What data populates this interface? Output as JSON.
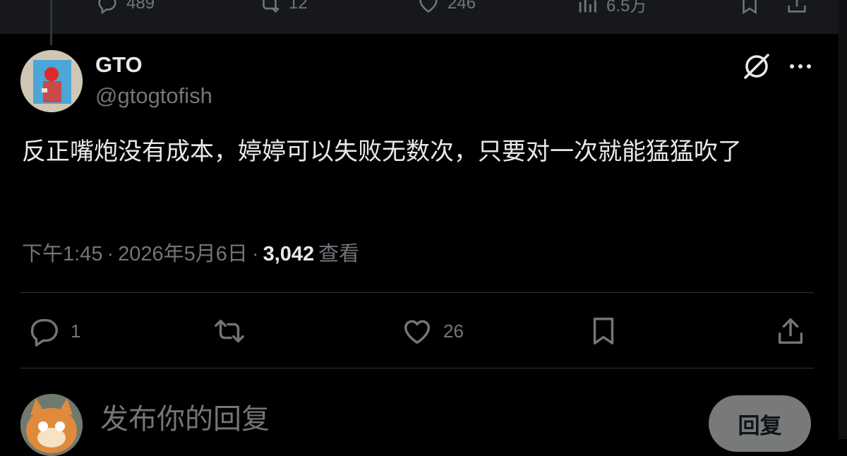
{
  "parent_actions": {
    "replies": "489",
    "retweets": "12",
    "likes": "246",
    "views": "6.5万"
  },
  "tweet": {
    "author_name": "GTO",
    "author_handle": "@gtogtofish",
    "text": "反正嘴炮没有成本，婷婷可以失败无数次，只要对一次就能猛猛吹了",
    "time": "下午1:45",
    "date": "2026年5月6日",
    "views_count": "3,042",
    "views_label": "查看",
    "separator": "·"
  },
  "actions": {
    "replies": "1",
    "retweets": "",
    "likes": "26"
  },
  "reply_box": {
    "placeholder": "发布你的回复",
    "button_label": "回复"
  },
  "colors": {
    "background": "#000000",
    "text_primary": "#e7e9ea",
    "text_secondary": "#71767b",
    "divider": "#2f3336",
    "reply_button": "#787a7a"
  },
  "icons": [
    "reply-icon",
    "retweet-icon",
    "like-icon",
    "views-icon",
    "bookmark-icon",
    "share-icon",
    "grok-icon",
    "more-icon"
  ]
}
